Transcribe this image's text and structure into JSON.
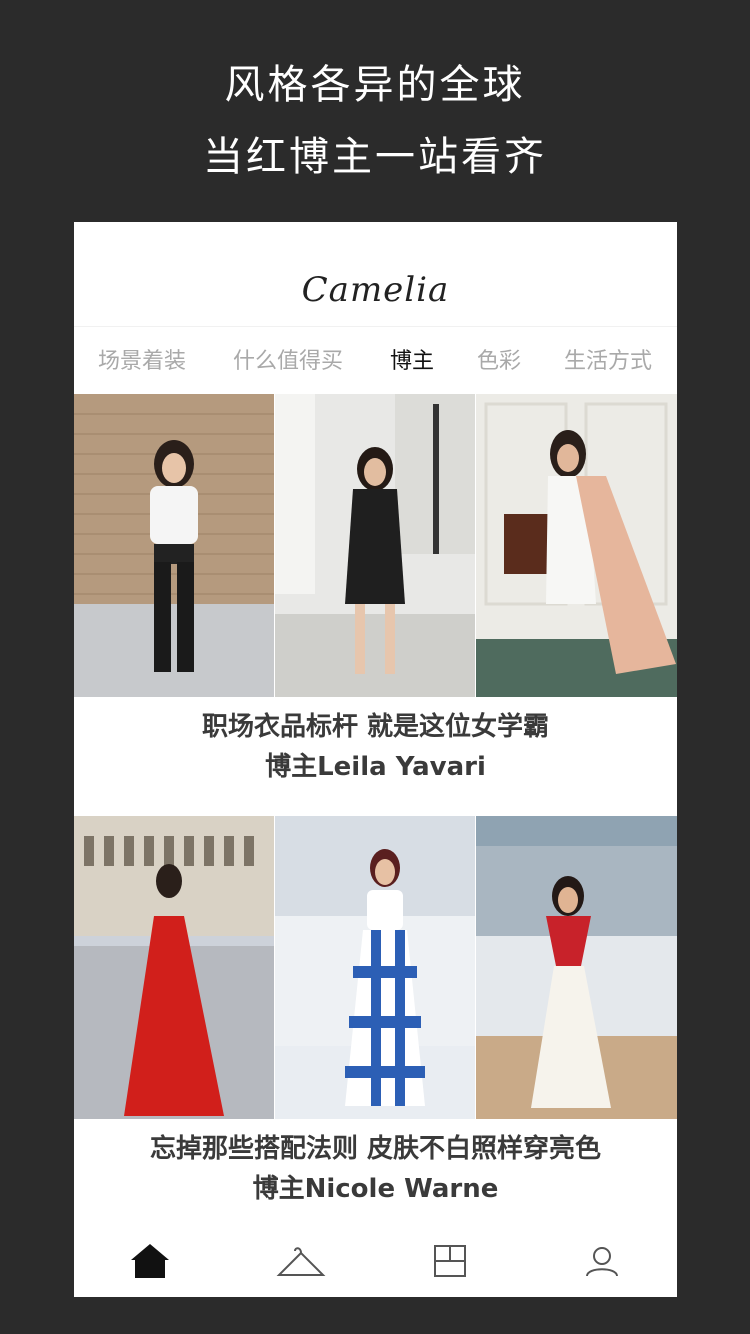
{
  "promo": {
    "line1": "风格各异的全球",
    "line2": "当红博主一站看齐"
  },
  "app": {
    "brand": "Camelia"
  },
  "tabs": [
    {
      "label": "场景着装",
      "active": false
    },
    {
      "label": "什么值得买",
      "active": false
    },
    {
      "label": "博主",
      "active": true
    },
    {
      "label": "色彩",
      "active": false
    },
    {
      "label": "生活方式",
      "active": false
    }
  ],
  "feed": [
    {
      "title": "职场衣品标杆 就是这位女学霸",
      "subtitle": "博主Leila Yavari"
    },
    {
      "title": "忘掉那些搭配法则 皮肤不白照样穿亮色",
      "subtitle": "博主Nicole Warne"
    }
  ],
  "bottom_nav": [
    {
      "icon": "home-icon",
      "active": true
    },
    {
      "icon": "hanger-icon",
      "active": false
    },
    {
      "icon": "grid-icon",
      "active": false
    },
    {
      "icon": "user-icon",
      "active": false
    }
  ],
  "colors": {
    "background": "#2b2b2b",
    "active_tab": "#111111",
    "inactive_tab": "#a9a9a9"
  }
}
